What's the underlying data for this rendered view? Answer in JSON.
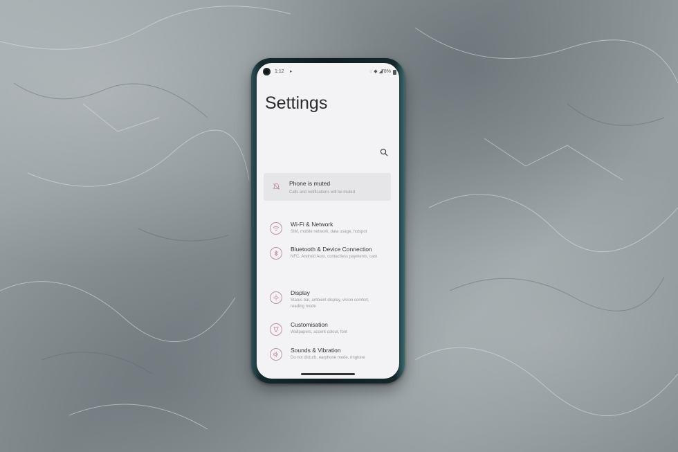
{
  "status_bar": {
    "time": "1:12",
    "play_icon": "play-icon",
    "icons": [
      "mute-icon",
      "wifi-icon",
      "signal-icon"
    ],
    "battery": "78%"
  },
  "page": {
    "title": "Settings"
  },
  "muted_banner": {
    "title": "Phone is muted",
    "subtitle": "Calls and notifications will be muted",
    "icon": "bell-off-icon"
  },
  "settings_items": [
    {
      "title": "Wi-Fi & Network",
      "subtitle": "SIM, mobile network, data usage, hotspot",
      "icon": "wifi-icon"
    },
    {
      "title": "Bluetooth & Device Connection",
      "subtitle": "NFC, Android Auto, contactless payments, cast",
      "icon": "bluetooth-icon"
    },
    {
      "title": "Display",
      "subtitle": "Status bar, ambient display, vision comfort, reading mode",
      "icon": "brightness-icon"
    },
    {
      "title": "Customisation",
      "subtitle": "Wallpapers, accent colour, font",
      "icon": "palette-icon"
    },
    {
      "title": "Sounds & Vibration",
      "subtitle": "Do not disturb, earphone mode, ringtone",
      "icon": "speaker-icon"
    }
  ],
  "colors": {
    "accent": "#c58ea6",
    "screen_bg": "#f3f3f5",
    "card_bg": "#e6e6e9"
  }
}
